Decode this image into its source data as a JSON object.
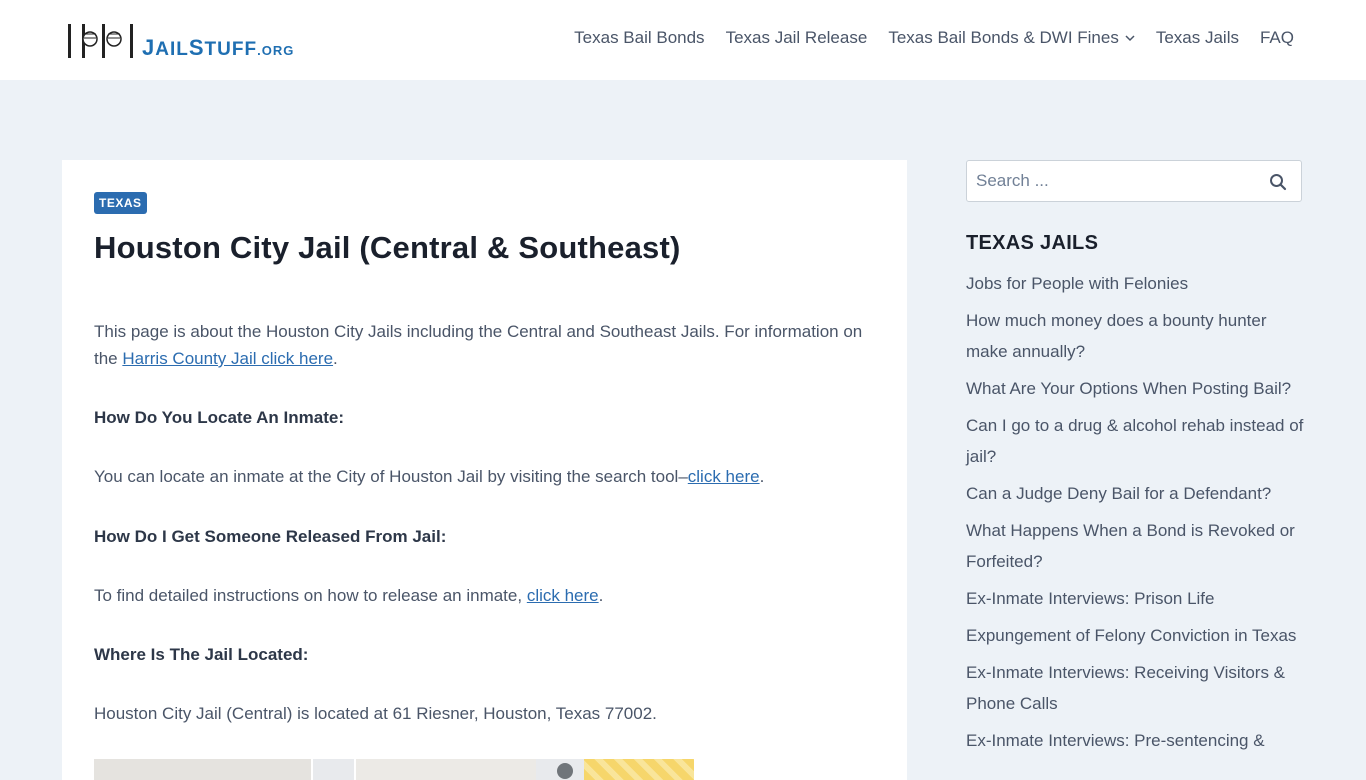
{
  "header": {
    "logo_text_big_j": "J",
    "logo_text_ail": "AIL",
    "logo_text_big_s": "S",
    "logo_text_tuff": "TUFF",
    "logo_text_org": ".ORG",
    "nav": [
      {
        "label": "Texas Bail Bonds"
      },
      {
        "label": "Texas Jail Release"
      },
      {
        "label": "Texas Bail Bonds & DWI Fines",
        "has_dropdown": true
      },
      {
        "label": "Texas Jails"
      },
      {
        "label": "FAQ"
      }
    ]
  },
  "article": {
    "category": "TEXAS",
    "title": "Houston City Jail (Central & Southeast)",
    "intro_text": "This page is about the Houston City Jails including the Central and Southeast Jails. For information on the ",
    "intro_link": "Harris County Jail click here",
    "intro_end": ".",
    "h_locate": "How Do You Locate An Inmate:",
    "locate_text": "You can locate an inmate at the City of Houston Jail by visiting the search tool–",
    "locate_link": "click here",
    "locate_end": ".",
    "h_release": "How Do I Get Someone Released From Jail:",
    "release_text": "To find detailed instructions on how to release an inmate, ",
    "release_link": "click here",
    "release_end": ".",
    "h_location": "Where Is The Jail Located:",
    "location_text": "Houston City Jail (Central) is located at 61 Riesner, Houston, Texas 77002."
  },
  "sidebar": {
    "search_placeholder": "Search ...",
    "section_title": "TEXAS JAILS",
    "items": [
      "Jobs for People with Felonies",
      "How much money does a bounty hunter make annually?",
      "What Are Your Options When Posting Bail?",
      "Can I go to a drug & alcohol rehab instead of jail?",
      "Can a Judge Deny Bail for a Defendant?",
      "What Happens When a Bond is Revoked or Forfeited?",
      "Ex-Inmate Interviews: Prison Life",
      "Expungement of Felony Conviction in Texas",
      "Ex-Inmate Interviews: Receiving Visitors & Phone Calls",
      "Ex-Inmate Interviews: Pre-sentencing &"
    ]
  },
  "colors": {
    "accent": "#2b6cb0",
    "logo_blue": "#1f6fb2",
    "page_bg": "#edf2f7"
  }
}
